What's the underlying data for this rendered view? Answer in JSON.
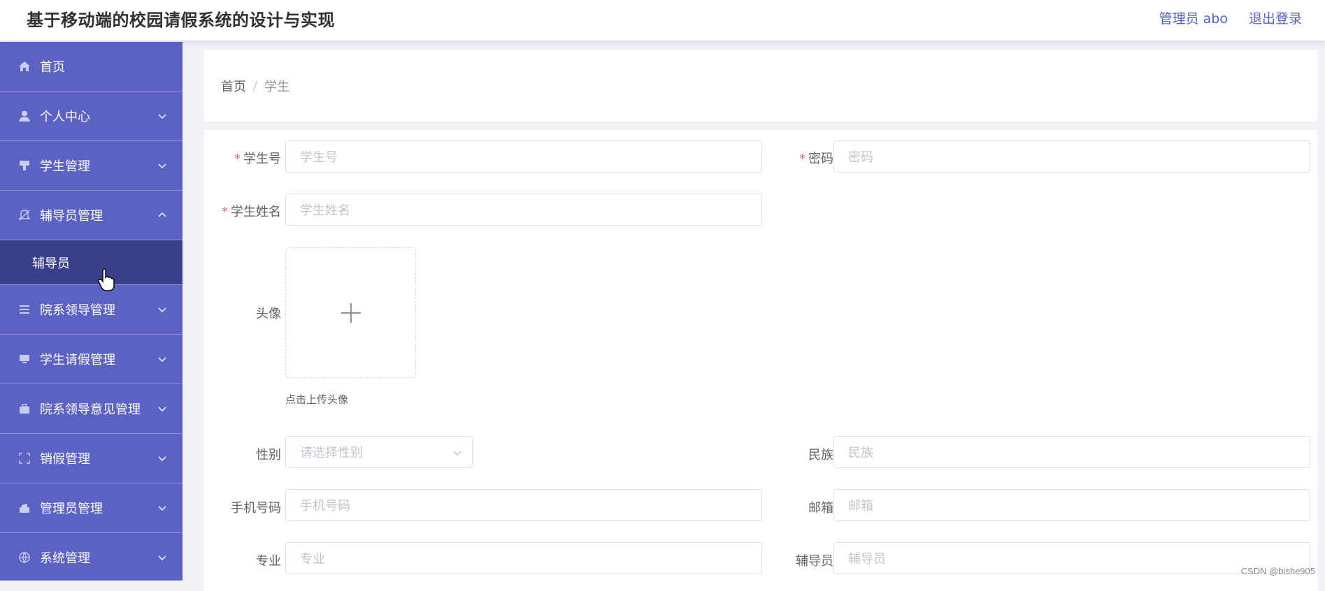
{
  "header": {
    "title": "基于移动端的校园请假系统的设计与实现",
    "user_label": "管理员 abo",
    "logout_label": "退出登录"
  },
  "sidebar": {
    "items": [
      {
        "label": "首页",
        "icon": "home-icon"
      },
      {
        "label": "个人中心",
        "icon": "user-icon"
      },
      {
        "label": "学生管理",
        "icon": "student-icon"
      },
      {
        "label": "辅导员管理",
        "icon": "bell-icon",
        "expanded": true,
        "sub": [
          {
            "label": "辅导员"
          }
        ]
      },
      {
        "label": "院系领导管理",
        "icon": "list-icon"
      },
      {
        "label": "学生请假管理",
        "icon": "monitor-icon"
      },
      {
        "label": "院系领导意见管理",
        "icon": "briefcase-icon"
      },
      {
        "label": "销假管理",
        "icon": "fullscreen-icon"
      },
      {
        "label": "管理员管理",
        "icon": "admin-icon"
      },
      {
        "label": "系统管理",
        "icon": "globe-icon"
      }
    ]
  },
  "breadcrumb": {
    "home": "首页",
    "separator": "/",
    "current": "学生"
  },
  "form": {
    "student_no": {
      "label": "学生号",
      "placeholder": "学生号"
    },
    "password": {
      "label": "密码",
      "placeholder": "密码"
    },
    "student_name": {
      "label": "学生姓名",
      "placeholder": "学生姓名"
    },
    "avatar": {
      "label": "头像",
      "tip": "点击上传头像"
    },
    "gender": {
      "label": "性别",
      "placeholder": "请选择性别"
    },
    "ethnicity": {
      "label": "民族",
      "placeholder": "民族"
    },
    "phone": {
      "label": "手机号码",
      "placeholder": "手机号码"
    },
    "email": {
      "label": "邮箱",
      "placeholder": "邮箱"
    },
    "major": {
      "label": "专业",
      "placeholder": "专业"
    },
    "counselor": {
      "label": "辅导员",
      "placeholder": "辅导员"
    }
  },
  "watermark": "CSDN @bishe905",
  "colors": {
    "sidebar_bg": "#5b62c4",
    "submenu_bg": "#3a3f8c",
    "accent": "#5361c4",
    "required": "#f56c6c"
  }
}
